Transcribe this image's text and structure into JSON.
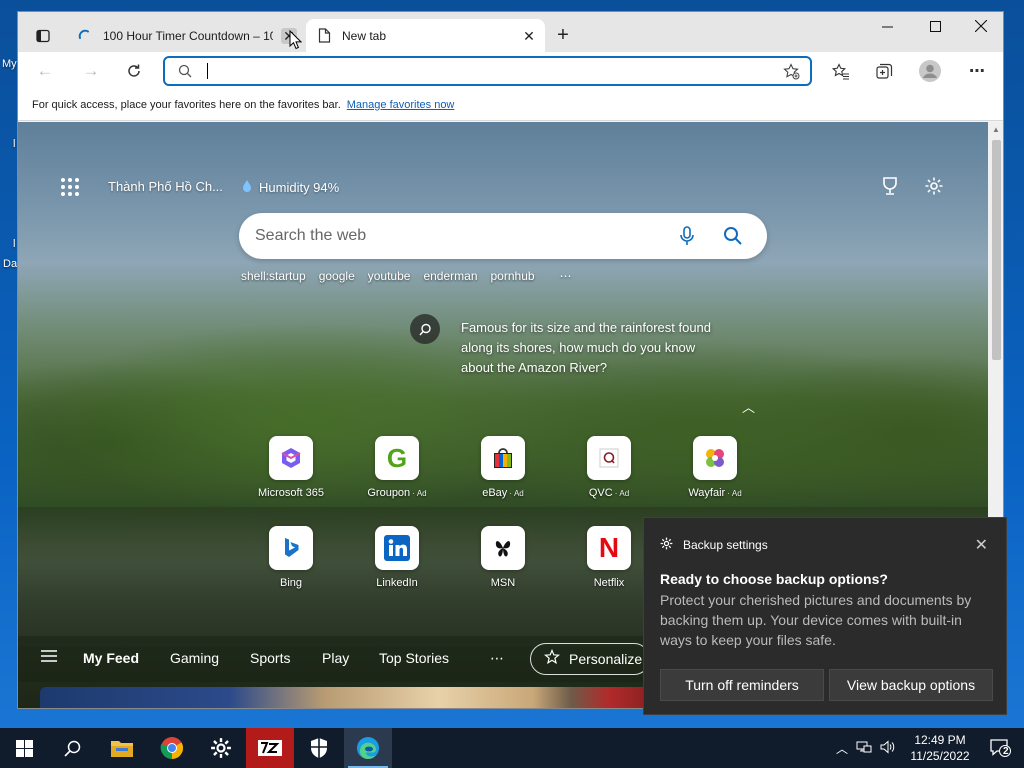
{
  "desktop": {
    "side_texts": [
      "My",
      "l",
      "l",
      "Da"
    ]
  },
  "browser": {
    "tabs": [
      {
        "title": "100 Hour Timer Countdown – 10",
        "loading": true
      },
      {
        "title": "New tab"
      }
    ],
    "new_tab_symbol": "+",
    "window_controls": [
      "minimize-icon",
      "maximize-icon",
      "close-icon"
    ],
    "address": {
      "value": "",
      "placeholder": ""
    },
    "favorites_bar": {
      "text": "For quick access, place your favorites here on the favorites bar.",
      "link": "Manage favorites now"
    }
  },
  "ntp": {
    "location": "Thành Phố Hồ Ch...",
    "weather": "Humidity 94%",
    "search_placeholder": "Search the web",
    "quick_links": [
      "shell:startup",
      "google",
      "youtube",
      "enderman",
      "pornhub"
    ],
    "fact": "Famous for its size and the rainforest found along its shores, how much do you know about the Amazon River?",
    "tiles_row1": [
      {
        "label": "Microsoft 365",
        "ad": ""
      },
      {
        "label": "Groupon",
        "ad": "Ad"
      },
      {
        "label": "eBay",
        "ad": "Ad"
      },
      {
        "label": "QVC",
        "ad": "Ad"
      },
      {
        "label": "Wayfair",
        "ad": "Ad"
      }
    ],
    "tiles_row2": [
      {
        "label": "Bing",
        "ad": ""
      },
      {
        "label": "LinkedIn",
        "ad": ""
      },
      {
        "label": "MSN",
        "ad": ""
      },
      {
        "label": "Netflix",
        "ad": ""
      }
    ],
    "feed_tabs": [
      "My Feed",
      "Gaming",
      "Sports",
      "Play",
      "Top Stories"
    ],
    "personalize_label": "Personalize"
  },
  "toast": {
    "app": "Backup settings",
    "title": "Ready to choose backup options?",
    "body": "Protect your cherished pictures and documents by backing them up. Your device comes with built-in ways to keep your files safe.",
    "button_secondary": "Turn off reminders",
    "button_primary": "View backup options"
  },
  "taskbar": {
    "time": "12:49 PM",
    "date": "11/25/2022",
    "notification_count": "2"
  },
  "colors": {
    "accent": "#0f6cbd",
    "toast_bg": "#2b2b2b",
    "taskbar_bg": "#101b2b"
  }
}
